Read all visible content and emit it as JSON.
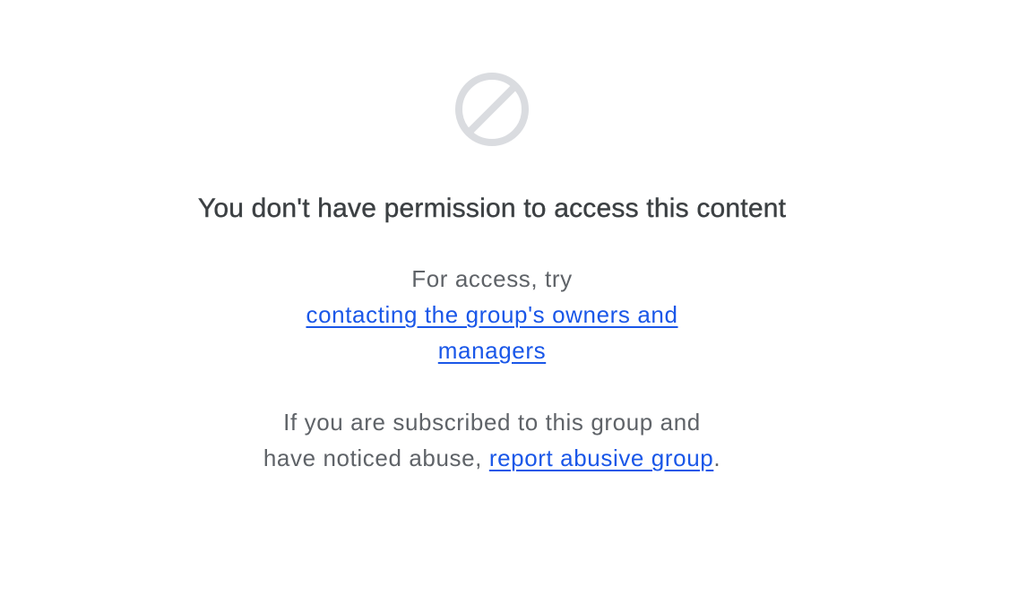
{
  "icon": {
    "name": "blocked-icon",
    "color": "#dadce0"
  },
  "heading": "You don't have permission to access this content",
  "access": {
    "prefix": "For access, try",
    "link_line1": "contacting the group's owners and",
    "link_line2": "managers"
  },
  "abuse": {
    "line1": "If you are subscribed to this group and",
    "line2_prefix": "have noticed abuse, ",
    "link": "report abusive group",
    "suffix": "."
  },
  "colors": {
    "heading": "#3c4043",
    "body": "#5f6368",
    "link": "#1a57e8"
  }
}
